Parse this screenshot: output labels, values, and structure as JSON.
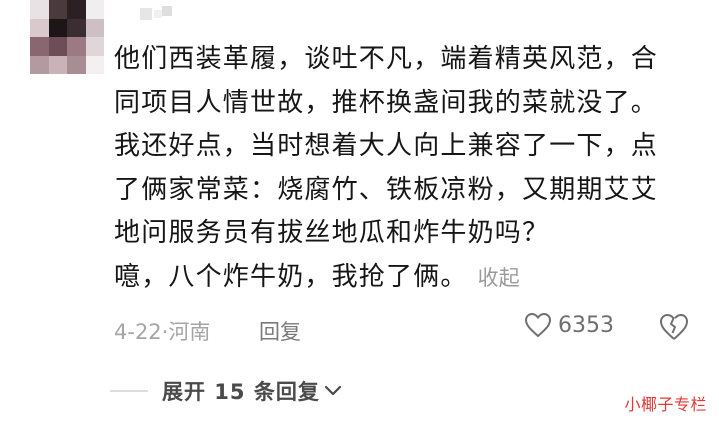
{
  "comment": {
    "lines": [
      "他们西装革履，谈吐不凡，端着精英风范，合",
      "同项目人情世故，推杯换盏间我的菜就没了。",
      "我还好点，当时想着大人向上兼容了一下，点",
      "了俩家常菜：烧腐竹、铁板凉粉，又期期艾艾",
      "地问服务员有拔丝地瓜和炸牛奶吗？",
      "噫，八个炸牛奶，我抢了俩。"
    ],
    "collapse_label": "收起"
  },
  "meta": {
    "date_location": "4-22·河南",
    "reply_label": "回复",
    "like_count": "6353"
  },
  "replies": {
    "expand_label": "展开 15 条回复"
  },
  "watermark": "小椰子专栏",
  "icons": {
    "like": "heart-outline-icon",
    "dislike": "broken-heart-icon",
    "expand": "chevron-down-icon",
    "more": "dots-icon"
  },
  "colors": {
    "text": "#161616",
    "meta_text": "#a5a5a5",
    "watermark": "#e53935"
  }
}
